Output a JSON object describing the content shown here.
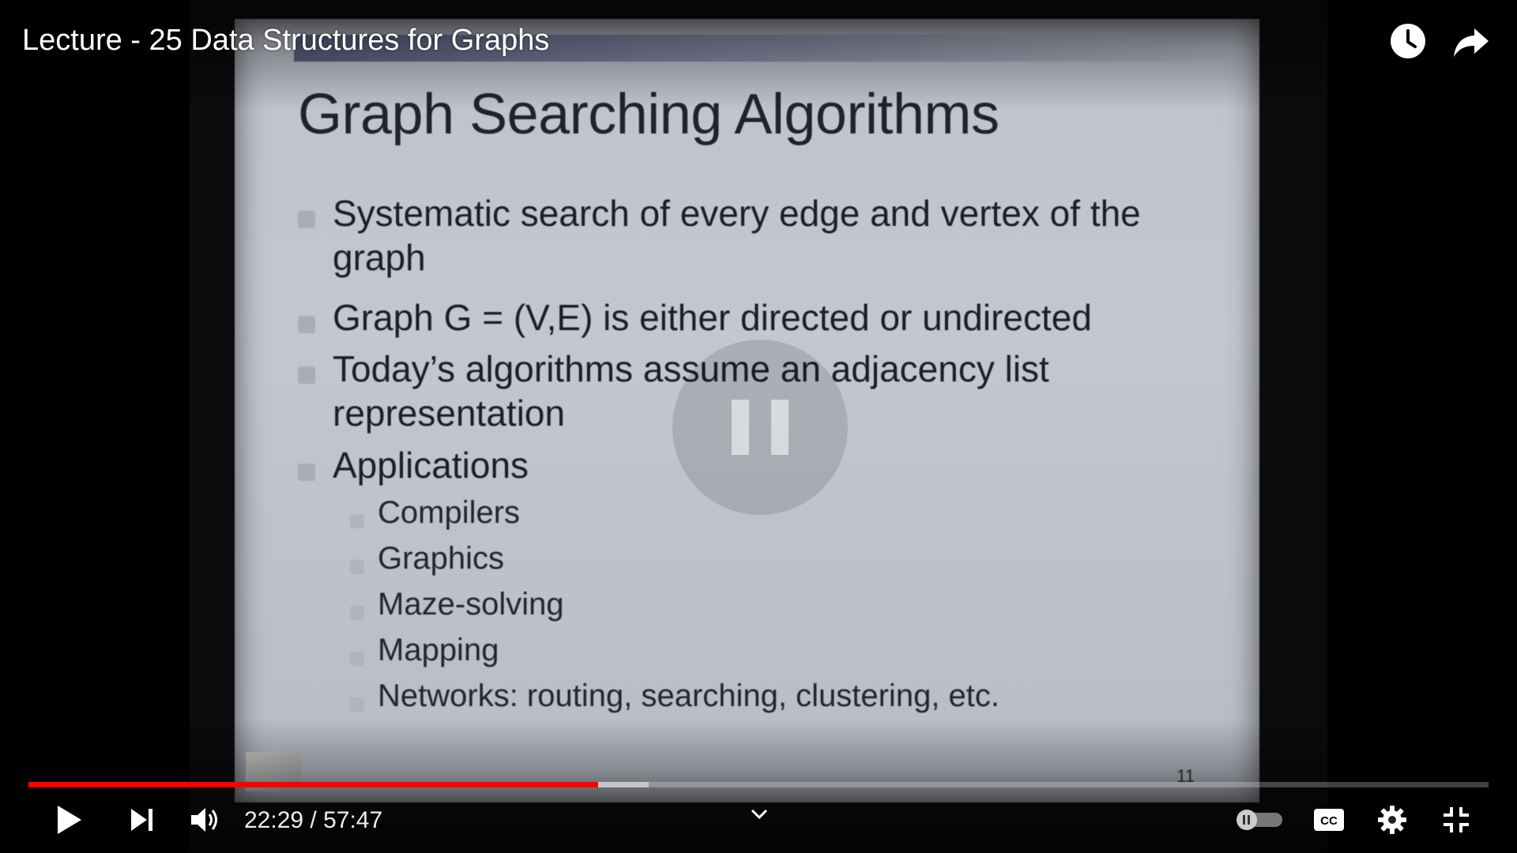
{
  "video": {
    "title": "Lecture - 25 Data Structures for Graphs"
  },
  "slide": {
    "title": "Graph Searching Algorithms",
    "bullets": [
      "Systematic search of every edge and vertex of the graph",
      "Graph G = (V,E) is either directed or undirected",
      "Today’s algorithms assume an adjacency list representation",
      "Applications"
    ],
    "applications": [
      "Compilers",
      "Graphics",
      "Maze-solving",
      "Mapping",
      "Networks: routing, searching, clustering, etc."
    ],
    "page_number": "11"
  },
  "controls": {
    "current_time": "22:29",
    "separator": " / ",
    "duration": "57:47",
    "progress_fraction": 0.39,
    "buffered_fraction": 0.425,
    "progress_color": "#ff0000"
  },
  "icons": {
    "watch_later": "clock-icon",
    "share": "share-arrow-icon",
    "play": "play-icon",
    "next": "next-icon",
    "volume": "volume-icon",
    "chevron": "chevron-down-icon",
    "autoplay": "autoplay-toggle-icon",
    "captions": "cc-icon",
    "settings": "gear-icon",
    "fullscreen_exit": "fullscreen-exit-icon"
  }
}
